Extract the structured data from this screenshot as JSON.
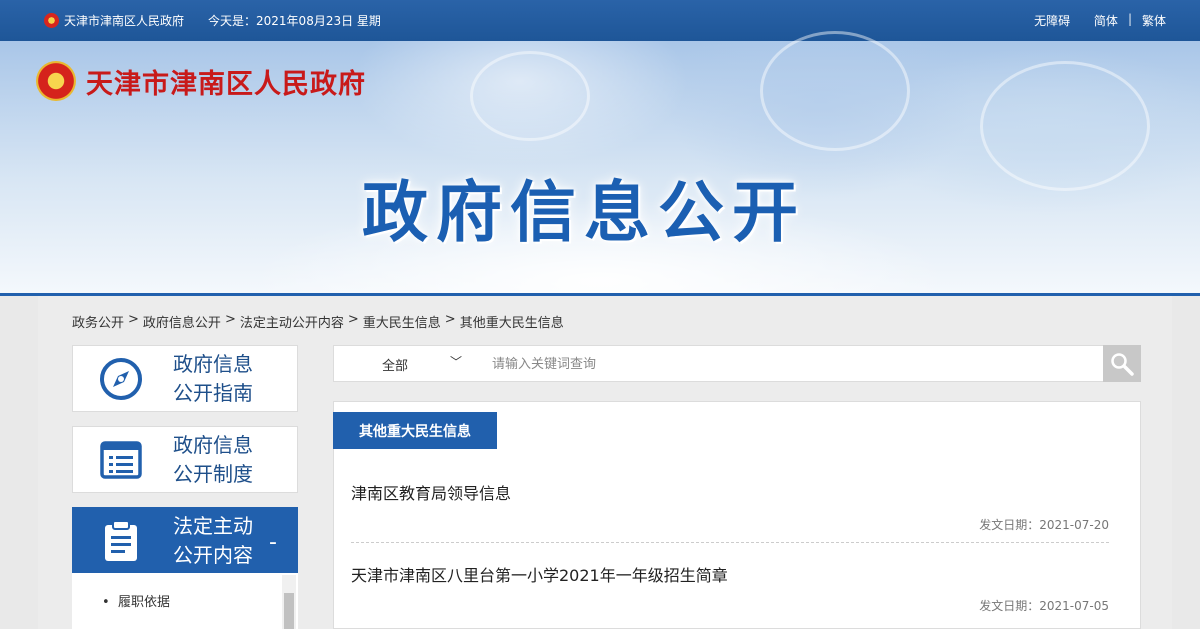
{
  "topbar": {
    "site_name": "天津市津南区人民政府",
    "today": "今天是：2021年08月23日 星期",
    "links": [
      "无障碍",
      "简体",
      "繁体"
    ]
  },
  "header": {
    "logo_text": "天津市津南区人民政府",
    "banner_title": "政府信息公开"
  },
  "breadcrumb": [
    "政务公开",
    "政府信息公开",
    "法定主动公开内容",
    "重大民生信息",
    "其他重大民生信息"
  ],
  "sidebar": {
    "items": [
      {
        "line1": "政府信息",
        "line2": "公开指南",
        "icon": "compass-icon"
      },
      {
        "line1": "政府信息",
        "line2": "公开制度",
        "icon": "list-document-icon"
      },
      {
        "line1": "法定主动",
        "line2": "公开内容",
        "icon": "clipboard-icon",
        "toggle": "-"
      }
    ],
    "submenu": [
      "履职依据"
    ]
  },
  "search": {
    "scope": "全部",
    "placeholder": "请输入关键词查询"
  },
  "panel": {
    "title": "其他重大民生信息",
    "items": [
      {
        "title": "津南区教育局领导信息",
        "date": "发文日期：2021-07-20"
      },
      {
        "title": "天津市津南区八里台第一小学2021年一年级招生简章",
        "date": "发文日期：2021-07-05"
      }
    ]
  },
  "colors": {
    "primary": "#2160ad",
    "logo_red": "#c81a1a"
  }
}
